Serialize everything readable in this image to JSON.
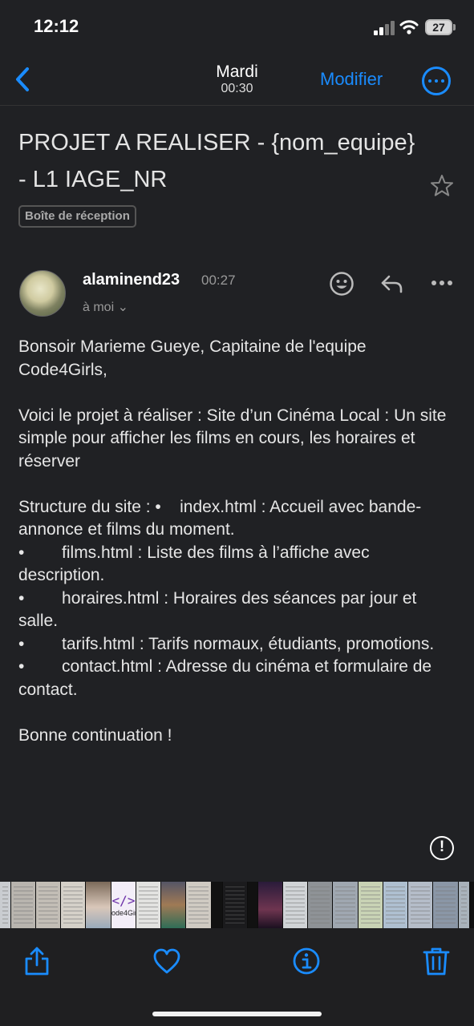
{
  "status_bar": {
    "time": "12:12",
    "battery": "27"
  },
  "nav": {
    "day": "Mardi",
    "time": "00:30",
    "edit_label": "Modifier"
  },
  "email": {
    "subject": "PROJET A REALISER - {nom_equipe} - L1 IAGE_NR",
    "mailbox": "Boîte de réception",
    "sender": "alaminend23",
    "sent_time": "00:27",
    "recipient": "à moi ⌄",
    "body": {
      "greeting": "Bonsoir Marieme Gueye, Capitaine de l'equipe Code4Girls,",
      "intro": "Voici le projet à réaliser : Site d’un Cinéma Local : Un site simple pour afficher les films en cours, les horaires et réserver",
      "structure_1": "Structure du site : •    index.html : Accueil avec bande-annonce et films du moment.",
      "structure_2": "•        films.html : Liste des films à l’affiche avec description.",
      "structure_3": "•        horaires.html : Horaires des séances par jour et salle.",
      "structure_4": "•        tarifs.html : Tarifs normaux, étudiants, promotions.",
      "structure_5": "•        contact.html : Adresse du cinéma et formulaire de contact.",
      "closing": "Bonne continuation !"
    }
  },
  "thumbnails": {
    "code_label": "</>",
    "code_caption": "ode4Girl"
  },
  "colors": {
    "accent": "#1a8cff",
    "background": "#202124"
  }
}
